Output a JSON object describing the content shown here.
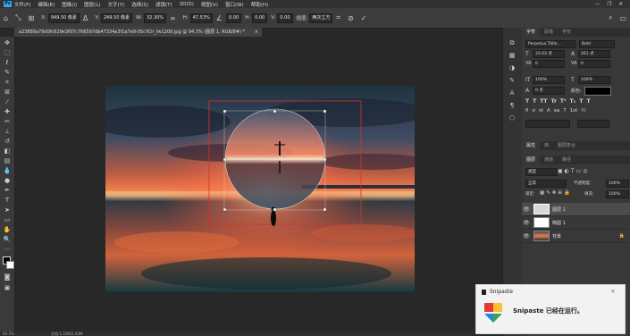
{
  "app": {
    "logo": "Ps"
  },
  "menu": [
    "文件(F)",
    "编辑(E)",
    "图像(I)",
    "图层(L)",
    "文字(Y)",
    "选择(S)",
    "滤镜(T)",
    "3D(D)",
    "视图(V)",
    "窗口(W)",
    "帮助(H)"
  ],
  "options": {
    "x_label": "X:",
    "x_value": "949.50 像素",
    "y_label": "Y:",
    "y_value": "249.50 像素",
    "w_label": "W:",
    "w_value": "32.30%",
    "h_label": "H:",
    "h_value": "47.53%",
    "angle_value": "0.00",
    "hskew_label": "H:",
    "hskew_value": "0.00",
    "vskew_label": "V:",
    "vskew_value": "0.00",
    "interp_label": "插值:",
    "interp_value": "两次立方",
    "cancel_icon": "cancel-circle",
    "commit_icon": "checkmark"
  },
  "document": {
    "tab_title": "a23889a79d0fc629e3f07c766597db47334a3f1a7e9-05cYCh_fw1200.jpg @ 94.3% (图层 1, RGB/8#) *",
    "close_glyph": "×"
  },
  "panels": {
    "type_tabs": [
      "字符",
      "段落",
      "字形"
    ],
    "font_family": "Perpetua Titlin...",
    "font_style": "Bold",
    "font_size": "33.03 点",
    "leading": "261 点",
    "tracking": "0",
    "kerning": "0",
    "scale_v": "100%",
    "scale_h": "100%",
    "baseline": "0 点",
    "color_label": "颜色:",
    "style_buttons": [
      "T",
      "T",
      "TT",
      "Tr",
      "T¹",
      "T₁",
      "T",
      "T"
    ],
    "extra_buttons": [
      "fi",
      "ơ",
      "st",
      "A",
      "aa",
      "T",
      "1st",
      "½"
    ],
    "props_tabs": [
      "属性",
      "库",
      "图层复合"
    ],
    "layer_tabs": [
      "图层",
      "通道",
      "路径"
    ],
    "kind_label": "类型",
    "blend_mode": "正常",
    "opacity_label": "不透明度:",
    "opacity_value": "100%",
    "lock_label": "锁定:",
    "fill_label": "填充:",
    "fill_value": "100%",
    "layers": [
      {
        "name": "图层 1",
        "selected": true
      },
      {
        "name": "椭圆 1",
        "selected": false
      },
      {
        "name": "背景",
        "selected": false
      }
    ]
  },
  "toast": {
    "title": "Snipaste",
    "message": "Snipaste 已经在运行。",
    "close_glyph": "×",
    "colors": [
      "#e53935",
      "#43a047",
      "#1e88e5",
      "#fbc02d"
    ]
  },
  "status": {
    "zoom": "94.3%",
    "doc": "文档:1.31M/1.43M"
  }
}
